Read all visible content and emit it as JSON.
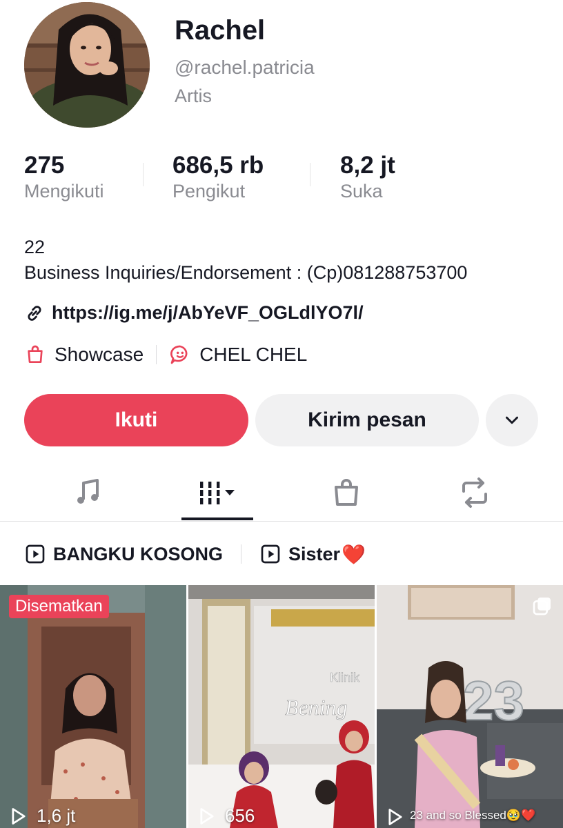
{
  "profile": {
    "name": "Rachel",
    "handle": "@rachel.patricia",
    "category": "Artis"
  },
  "stats": [
    {
      "value": "275",
      "label": "Mengikuti"
    },
    {
      "value": "686,5 rb",
      "label": "Pengikut"
    },
    {
      "value": "8,2 jt",
      "label": "Suka"
    }
  ],
  "bio": {
    "line1": "22",
    "line2": "Business Inquiries/Endorsement : (Cp)081288753700"
  },
  "link": {
    "url": "https://ig.me/j/AbYeVF_OGLdlYO7l/",
    "icon": "link-icon"
  },
  "features": {
    "showcase": "Showcase",
    "group": "CHEL CHEL"
  },
  "actions": {
    "follow": "Ikuti",
    "message": "Kirim pesan"
  },
  "tabs": [
    {
      "icon": "music-icon",
      "active": false
    },
    {
      "icon": "videos-grid-icon",
      "active": true
    },
    {
      "icon": "shop-bag-icon",
      "active": false
    },
    {
      "icon": "repost-icon",
      "active": false
    }
  ],
  "playlists": [
    {
      "label": "BANGKU KOSONG"
    },
    {
      "label": "Sister",
      "emoji": "❤️"
    }
  ],
  "videos": [
    {
      "views": "1,6 jt",
      "pinned_label": "Disematkan"
    },
    {
      "views": "656"
    },
    {
      "views": "",
      "caption": "23 and so Blessed🥹❤️"
    }
  ],
  "colors": {
    "accent": "#ea4359",
    "text": "#161823",
    "muted": "#8a8b91",
    "button_secondary": "#f1f1f2"
  }
}
